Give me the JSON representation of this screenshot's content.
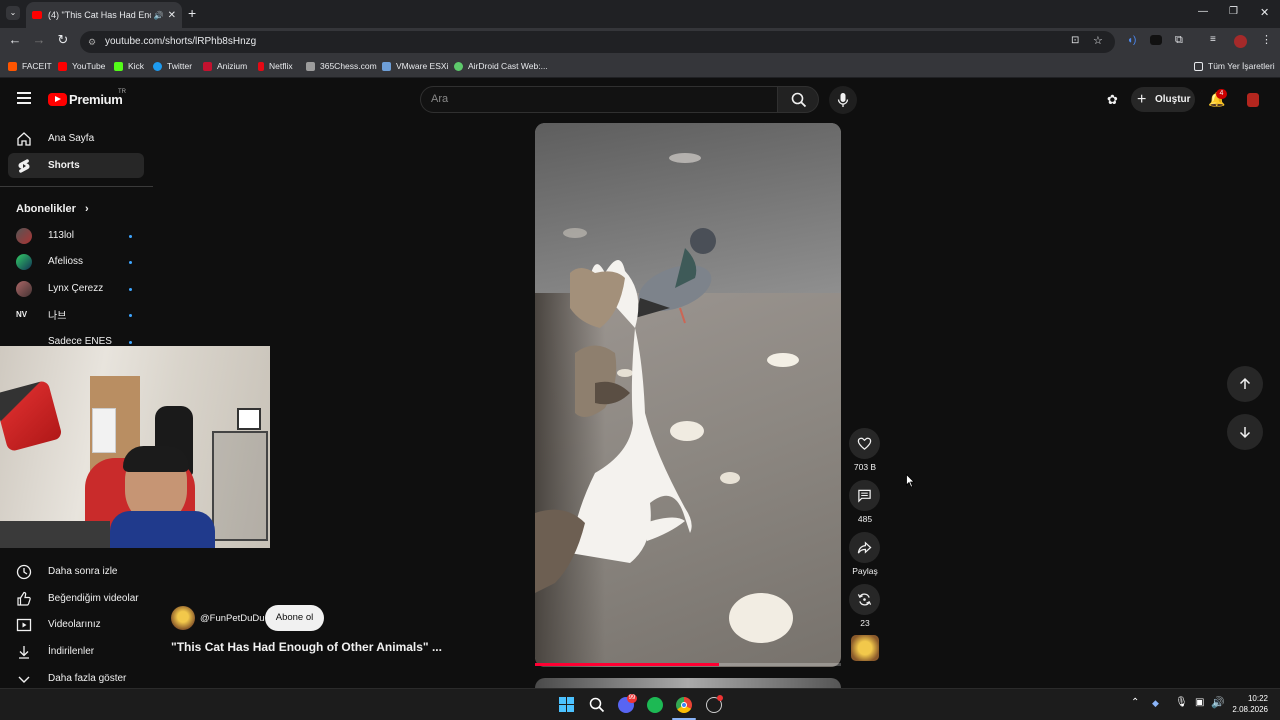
{
  "browser": {
    "tab_title": "(4) \"This Cat Has Had Enou",
    "url": "youtube.com/shorts/lRPhb8sHnzg",
    "bookmarks": [
      "FACEIT",
      "YouTube",
      "Kick",
      "Twitter",
      "Anizium",
      "Netflix",
      "365Chess.com",
      "VMware ESXi",
      "AirDroid Cast Web:..."
    ],
    "all_bookmarks": "Tüm Yer İşaretleri"
  },
  "header": {
    "logo_text": "Premium",
    "logo_region": "TR",
    "search_placeholder": "Ara",
    "create_label": "Oluştur",
    "notification_count": "4"
  },
  "sidebar": {
    "home": "Ana Sayfa",
    "shorts": "Shorts",
    "subscriptions_title": "Abonelikler",
    "subscriptions": [
      "113lol",
      "Afelioss",
      "Lynx Çerezz",
      "나브",
      "Sadece ENES"
    ],
    "watch_later": "Daha sonra izle",
    "liked": "Beğendiğim videolar",
    "your_videos": "Videolarınız",
    "downloads": "İndirilenler",
    "show_more": "Daha fazla göster"
  },
  "video": {
    "channel": "@FunPetDuDu",
    "subscribe_label": "Abone ol",
    "title": "\"This Cat Has Had Enough of Other Animals\" ...",
    "progress_percent": 60,
    "likes": "703 B",
    "comments": "485",
    "share_label": "Paylaş",
    "remix_count": "23"
  },
  "taskbar": {
    "time": "10:22",
    "date": "2.08.2026",
    "discord_badge": "99"
  },
  "colors": {
    "accent_red": "#ff0033",
    "background": "#0f0f0f"
  }
}
